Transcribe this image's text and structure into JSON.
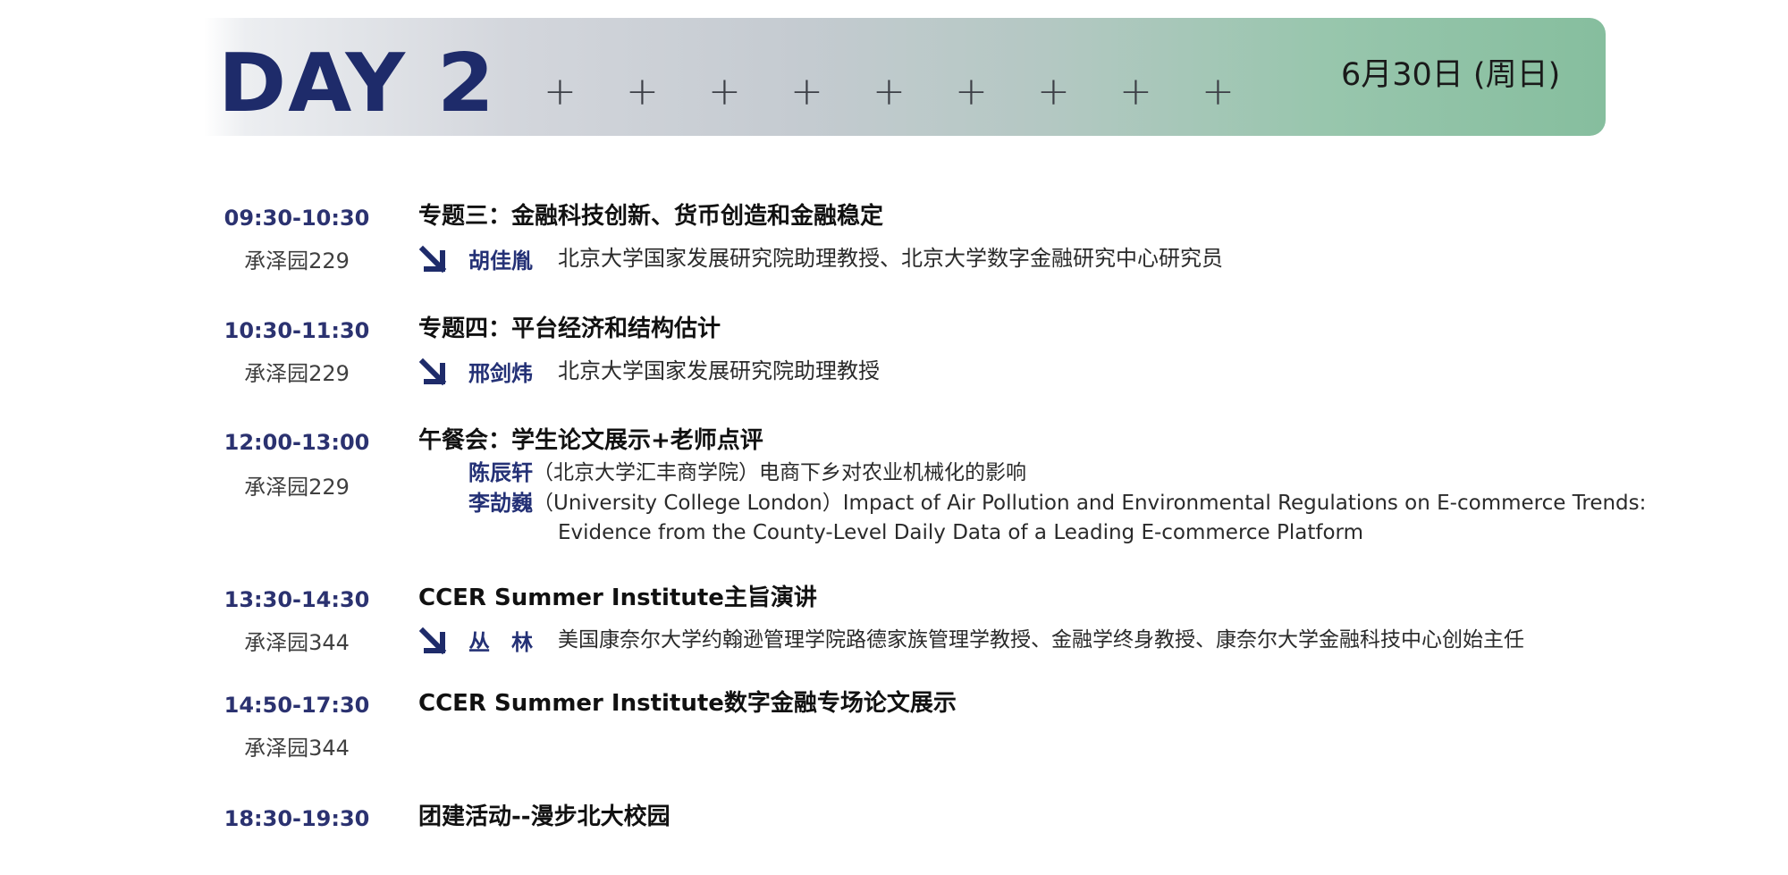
{
  "header": {
    "day_label": "DAY 2",
    "date": "6月30日 (周日)",
    "decorations": [
      "+",
      "+",
      "+",
      "+",
      "+",
      "+",
      "+",
      "+",
      "+"
    ]
  },
  "colors": {
    "primary_navy": "#1e2b6a",
    "banner_left": "#d3d6dc",
    "banner_right": "#86be9e"
  },
  "sessions": [
    {
      "time": "09:30-10:30",
      "room": "承泽园229",
      "title": "专题三：金融科技创新、货币创造和金融稳定",
      "speaker": "胡佳胤",
      "affiliation": "北京大学国家发展研究院助理教授、北京大学数字金融研究中心研究员",
      "icon": "arrow-down-right-icon"
    },
    {
      "time": "10:30-11:30",
      "room": "承泽园229",
      "title": "专题四：平台经济和结构估计",
      "speaker": "邢剑炜",
      "affiliation": "北京大学国家发展研究院助理教授",
      "icon": "arrow-down-right-icon"
    },
    {
      "time": "12:00-13:00",
      "room": "承泽园229",
      "title": "午餐会：学生论文展示+老师点评",
      "presentations": [
        {
          "name": "陈辰轩",
          "text": "（北京大学汇丰商学院）电商下乡对农业机械化的影响"
        },
        {
          "name": "李劼巍",
          "text": "（University College London）Impact of Air Pollution and Environmental Regulations on E-commerce Trends:",
          "continuation": "Evidence from the County-Level Daily Data of a Leading E-commerce Platform"
        }
      ]
    },
    {
      "time": "13:30-14:30",
      "room": "承泽园344",
      "title": "CCER Summer Institute主旨演讲",
      "speaker": "丛　林",
      "affiliation": "美国康奈尔大学约翰逊管理学院路德家族管理学教授、金融学终身教授、康奈尔大学金融科技中心创始主任",
      "icon": "arrow-down-right-icon"
    },
    {
      "time": "14:50-17:30",
      "room": "承泽园344",
      "title": "CCER Summer Institute数字金融专场论文展示"
    },
    {
      "time": "18:30-19:30",
      "title": "团建活动--漫步北大校园"
    }
  ]
}
